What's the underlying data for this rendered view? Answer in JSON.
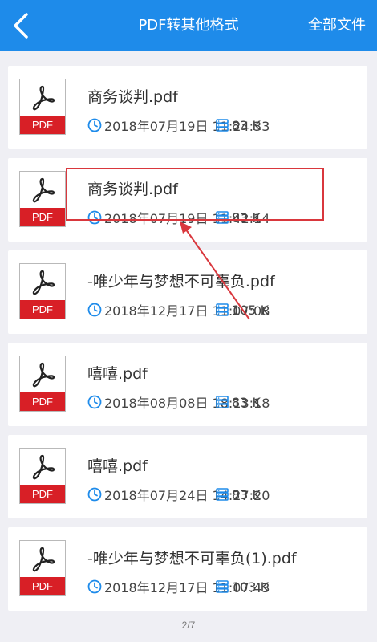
{
  "header": {
    "title": "PDF转其他格式",
    "right_action": "全部文件",
    "accent_color": "#1e8bea"
  },
  "files": [
    {
      "name": "商务谈判.pdf",
      "datetime": "2018年07月19日 11:24:33",
      "size": "83 K",
      "icon_label": "PDF"
    },
    {
      "name": "商务谈判.pdf",
      "datetime": "2018年07月19日 11:42:14",
      "size": "83 K",
      "icon_label": "PDF"
    },
    {
      "name": "-唯少年与梦想不可辜负.pdf",
      "datetime": "2018年12月17日 11:07:08",
      "size": "105 K",
      "icon_label": "PDF"
    },
    {
      "name": "嘻嘻.pdf",
      "datetime": "2018年08月08日 18:13:18",
      "size": "83 K",
      "icon_label": "PDF"
    },
    {
      "name": "嘻嘻.pdf",
      "datetime": "2018年07月24日 14:27:20",
      "size": "83 K",
      "icon_label": "PDF"
    },
    {
      "name": "-唯少年与梦想不可辜负(1).pdf",
      "datetime": "2018年12月17日 11:07:43",
      "size": "103 K",
      "icon_label": "PDF"
    }
  ],
  "page_indicator": "2/7",
  "icons": {
    "back": "chevron-left-icon",
    "file": "pdf-file-icon",
    "time": "clock-icon",
    "size": "database-icon"
  },
  "annotation_color": "#d9373d"
}
